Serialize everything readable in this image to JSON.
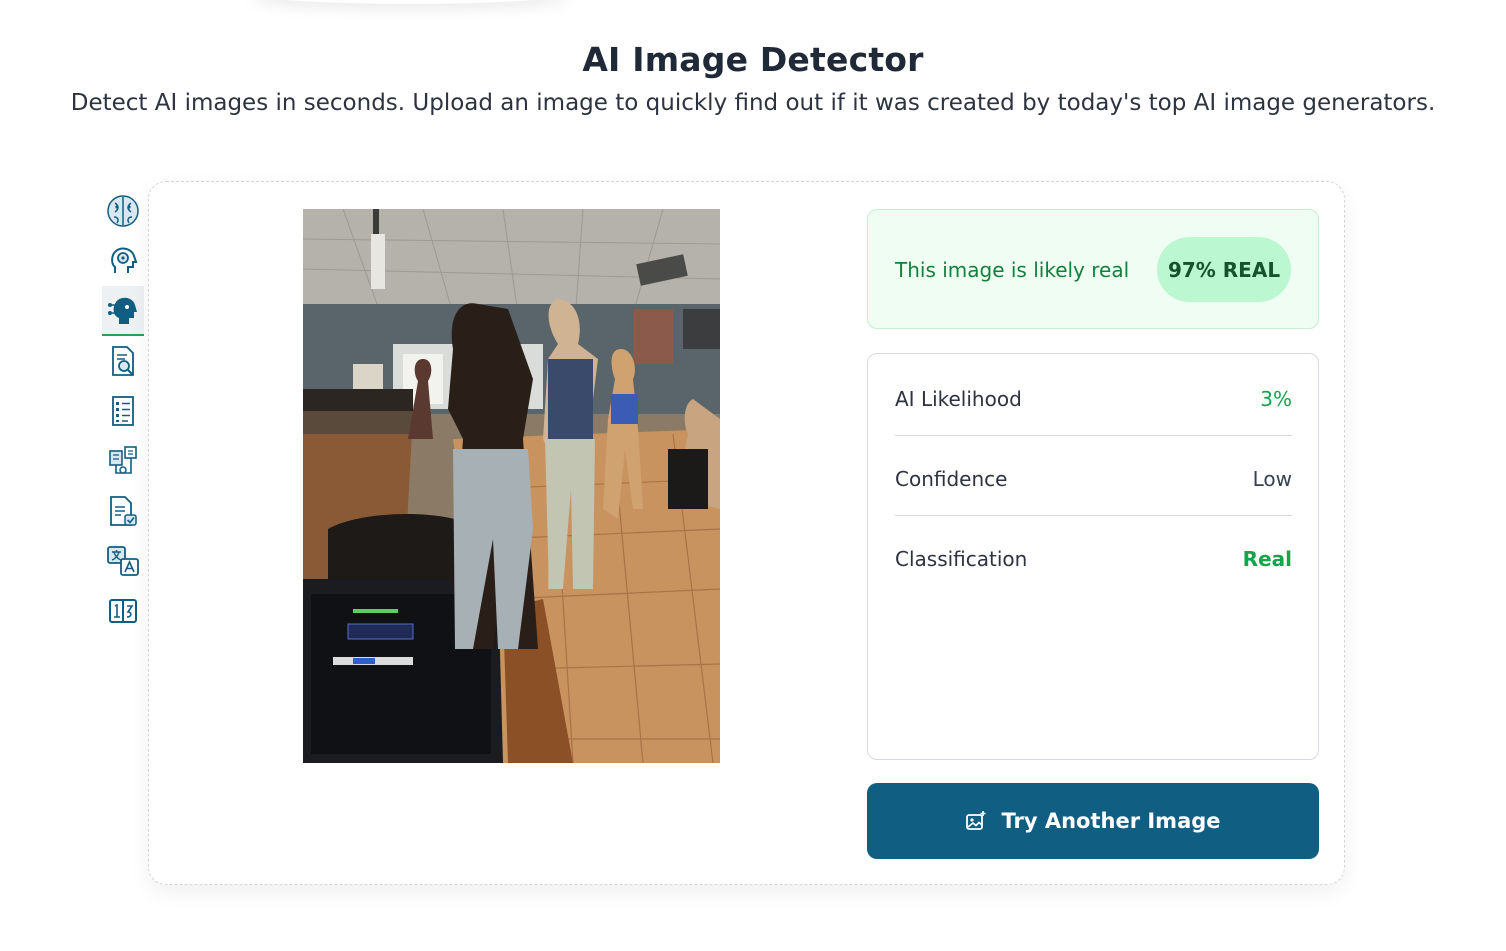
{
  "header": {
    "title": "AI Image Detector",
    "subtitle": "Detect AI images in seconds. Upload an image to quickly find out if it was created by today's top AI image generators."
  },
  "sidebar": {
    "items": [
      {
        "icon": "brain-icon",
        "active": false
      },
      {
        "icon": "ai-head-icon",
        "active": false
      },
      {
        "icon": "ai-face-icon",
        "active": true
      },
      {
        "icon": "document-search-icon",
        "active": false
      },
      {
        "icon": "checklist-icon",
        "active": false
      },
      {
        "icon": "data-flow-icon",
        "active": false
      },
      {
        "icon": "document-check-icon",
        "active": false
      },
      {
        "icon": "translate-icon",
        "active": false
      },
      {
        "icon": "compare-icon",
        "active": false
      }
    ]
  },
  "result": {
    "verdict_text": "This image is likely real",
    "badge": "97% REAL",
    "metrics": [
      {
        "label": "AI Likelihood",
        "value": "3%"
      },
      {
        "label": "Confidence",
        "value": "Low"
      },
      {
        "label": "Classification",
        "value": "Real"
      }
    ]
  },
  "actions": {
    "try_another_label": "Try Another Image",
    "try_another_icon": "image-sparkle-icon"
  },
  "colors": {
    "accent": "#115e83",
    "success": "#16a34a",
    "success_bg": "#effdf3",
    "badge_bg": "#bbf7d0",
    "badge_text": "#14532d"
  }
}
